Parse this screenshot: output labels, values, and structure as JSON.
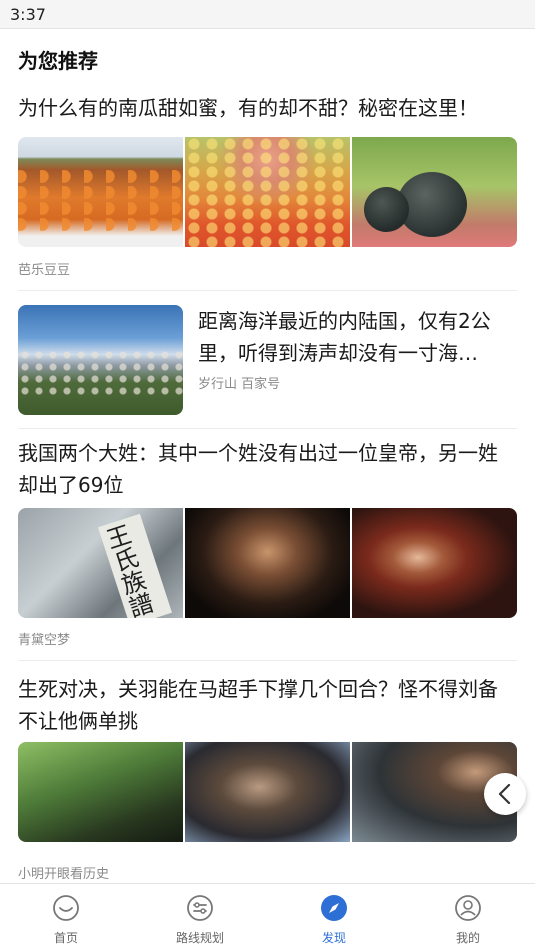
{
  "status": {
    "time": "3:37"
  },
  "section_title": "为您推荐",
  "articles": [
    {
      "title": "为什么有的南瓜甜如蜜，有的却不甜？秘密在这里！",
      "source": "芭乐豆豆"
    },
    {
      "title": "距离海洋最近的内陆国，仅有2公里，听得到涛声却没有一寸海…",
      "source": "岁行山 百家号"
    },
    {
      "title": "我国两个大姓：其中一个姓没有出过一位皇帝，另一姓却出了69位",
      "source": "青黛空梦"
    },
    {
      "title": "生死对决，关羽能在马超手下撑几个回合？怪不得刘备不让他俩单挑",
      "source": "小明开眼看历史"
    }
  ],
  "tabs": [
    {
      "label": "首页",
      "icon": "home-icon"
    },
    {
      "label": "路线规划",
      "icon": "route-icon"
    },
    {
      "label": "发现",
      "icon": "compass-icon",
      "active": true
    },
    {
      "label": "我的",
      "icon": "profile-icon"
    }
  ],
  "colors": {
    "accent": "#2e6fd6",
    "divider": "#ececec",
    "muted_text": "#8a8a8a"
  }
}
